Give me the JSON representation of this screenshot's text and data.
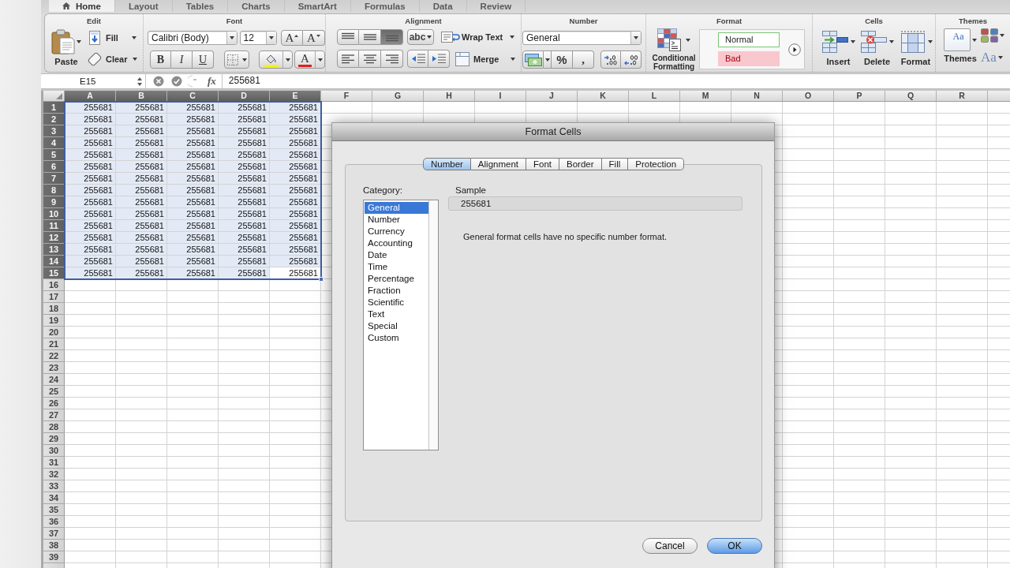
{
  "ribbon_tabs": [
    {
      "label": "Home",
      "selected": true
    },
    {
      "label": "Layout",
      "selected": false
    },
    {
      "label": "Tables",
      "selected": false
    },
    {
      "label": "Charts",
      "selected": false
    },
    {
      "label": "SmartArt",
      "selected": false
    },
    {
      "label": "Formulas",
      "selected": false
    },
    {
      "label": "Data",
      "selected": false
    },
    {
      "label": "Review",
      "selected": false
    }
  ],
  "ribbon": {
    "edit": {
      "title": "Edit",
      "paste": "Paste",
      "fill": "Fill",
      "clear": "Clear"
    },
    "font": {
      "title": "Font",
      "font_name": "Calibri (Body)",
      "font_size": "12",
      "grow_font": "A",
      "shrink_font": "A",
      "bold": "B",
      "italic": "I",
      "underline": "U",
      "font_color": "A"
    },
    "alignment": {
      "title": "Alignment",
      "vertical": [
        {
          "kind": "top",
          "selected": false
        },
        {
          "kind": "middle",
          "selected": false
        },
        {
          "kind": "bottom",
          "selected": true
        }
      ],
      "orientation": "abc",
      "wrap_text": "Wrap Text",
      "horizontal": [
        {
          "kind": "left",
          "selected": false
        },
        {
          "kind": "center",
          "selected": false
        },
        {
          "kind": "right",
          "selected": false
        }
      ],
      "merge": "Merge"
    },
    "number": {
      "title": "Number",
      "format": "General",
      "percent": "%",
      "comma": ","
    },
    "format": {
      "title": "Format",
      "conditional_formatting": "Conditional Formatting",
      "styles": [
        {
          "label": "Normal",
          "kind": "normal"
        },
        {
          "label": "Bad",
          "kind": "bad"
        }
      ]
    },
    "cells": {
      "title": "Cells",
      "buttons": [
        {
          "label": "Insert",
          "kind": "insert"
        },
        {
          "label": "Delete",
          "kind": "delete"
        },
        {
          "label": "Format",
          "kind": "format"
        }
      ]
    },
    "themes": {
      "title": "Themes",
      "button": "Themes",
      "preview": "Aa",
      "fonts": "Aa"
    }
  },
  "formula_bar": {
    "name_box": "E15",
    "function_label": "fx",
    "value": "255681"
  },
  "sheet": {
    "columns": [
      {
        "label": "A",
        "selected": true
      },
      {
        "label": "B",
        "selected": true
      },
      {
        "label": "C",
        "selected": true
      },
      {
        "label": "D",
        "selected": true
      },
      {
        "label": "E",
        "selected": true
      },
      {
        "label": "F",
        "selected": false
      },
      {
        "label": "G",
        "selected": false
      },
      {
        "label": "H",
        "selected": false
      },
      {
        "label": "I",
        "selected": false
      },
      {
        "label": "J",
        "selected": false
      },
      {
        "label": "K",
        "selected": false
      },
      {
        "label": "L",
        "selected": false
      },
      {
        "label": "M",
        "selected": false
      },
      {
        "label": "N",
        "selected": false
      },
      {
        "label": "O",
        "selected": false
      },
      {
        "label": "P",
        "selected": false
      },
      {
        "label": "Q",
        "selected": false
      },
      {
        "label": "R",
        "selected": false
      }
    ],
    "rows": [
      {
        "label": "1",
        "selected": true,
        "cells": [
          {
            "value": "255681",
            "active": false
          },
          {
            "value": "255681",
            "active": false
          },
          {
            "value": "255681",
            "active": false
          },
          {
            "value": "255681",
            "active": false
          },
          {
            "value": "255681",
            "active": false
          }
        ]
      },
      {
        "label": "2",
        "selected": true,
        "cells": [
          {
            "value": "255681",
            "active": false
          },
          {
            "value": "255681",
            "active": false
          },
          {
            "value": "255681",
            "active": false
          },
          {
            "value": "255681",
            "active": false
          },
          {
            "value": "255681",
            "active": false
          }
        ]
      },
      {
        "label": "3",
        "selected": true,
        "cells": [
          {
            "value": "255681",
            "active": false
          },
          {
            "value": "255681",
            "active": false
          },
          {
            "value": "255681",
            "active": false
          },
          {
            "value": "255681",
            "active": false
          },
          {
            "value": "255681",
            "active": false
          }
        ]
      },
      {
        "label": "4",
        "selected": true,
        "cells": [
          {
            "value": "255681",
            "active": false
          },
          {
            "value": "255681",
            "active": false
          },
          {
            "value": "255681",
            "active": false
          },
          {
            "value": "255681",
            "active": false
          },
          {
            "value": "255681",
            "active": false
          }
        ]
      },
      {
        "label": "5",
        "selected": true,
        "cells": [
          {
            "value": "255681",
            "active": false
          },
          {
            "value": "255681",
            "active": false
          },
          {
            "value": "255681",
            "active": false
          },
          {
            "value": "255681",
            "active": false
          },
          {
            "value": "255681",
            "active": false
          }
        ]
      },
      {
        "label": "6",
        "selected": true,
        "cells": [
          {
            "value": "255681",
            "active": false
          },
          {
            "value": "255681",
            "active": false
          },
          {
            "value": "255681",
            "active": false
          },
          {
            "value": "255681",
            "active": false
          },
          {
            "value": "255681",
            "active": false
          }
        ]
      },
      {
        "label": "7",
        "selected": true,
        "cells": [
          {
            "value": "255681",
            "active": false
          },
          {
            "value": "255681",
            "active": false
          },
          {
            "value": "255681",
            "active": false
          },
          {
            "value": "255681",
            "active": false
          },
          {
            "value": "255681",
            "active": false
          }
        ]
      },
      {
        "label": "8",
        "selected": true,
        "cells": [
          {
            "value": "255681",
            "active": false
          },
          {
            "value": "255681",
            "active": false
          },
          {
            "value": "255681",
            "active": false
          },
          {
            "value": "255681",
            "active": false
          },
          {
            "value": "255681",
            "active": false
          }
        ]
      },
      {
        "label": "9",
        "selected": true,
        "cells": [
          {
            "value": "255681",
            "active": false
          },
          {
            "value": "255681",
            "active": false
          },
          {
            "value": "255681",
            "active": false
          },
          {
            "value": "255681",
            "active": false
          },
          {
            "value": "255681",
            "active": false
          }
        ]
      },
      {
        "label": "10",
        "selected": true,
        "cells": [
          {
            "value": "255681",
            "active": false
          },
          {
            "value": "255681",
            "active": false
          },
          {
            "value": "255681",
            "active": false
          },
          {
            "value": "255681",
            "active": false
          },
          {
            "value": "255681",
            "active": false
          }
        ]
      },
      {
        "label": "11",
        "selected": true,
        "cells": [
          {
            "value": "255681",
            "active": false
          },
          {
            "value": "255681",
            "active": false
          },
          {
            "value": "255681",
            "active": false
          },
          {
            "value": "255681",
            "active": false
          },
          {
            "value": "255681",
            "active": false
          }
        ]
      },
      {
        "label": "12",
        "selected": true,
        "cells": [
          {
            "value": "255681",
            "active": false
          },
          {
            "value": "255681",
            "active": false
          },
          {
            "value": "255681",
            "active": false
          },
          {
            "value": "255681",
            "active": false
          },
          {
            "value": "255681",
            "active": false
          }
        ]
      },
      {
        "label": "13",
        "selected": true,
        "cells": [
          {
            "value": "255681",
            "active": false
          },
          {
            "value": "255681",
            "active": false
          },
          {
            "value": "255681",
            "active": false
          },
          {
            "value": "255681",
            "active": false
          },
          {
            "value": "255681",
            "active": false
          }
        ]
      },
      {
        "label": "14",
        "selected": true,
        "cells": [
          {
            "value": "255681",
            "active": false
          },
          {
            "value": "255681",
            "active": false
          },
          {
            "value": "255681",
            "active": false
          },
          {
            "value": "255681",
            "active": false
          },
          {
            "value": "255681",
            "active": false
          }
        ]
      },
      {
        "label": "15",
        "selected": true,
        "cells": [
          {
            "value": "255681",
            "active": false
          },
          {
            "value": "255681",
            "active": false
          },
          {
            "value": "255681",
            "active": false
          },
          {
            "value": "255681",
            "active": false
          },
          {
            "value": "255681",
            "active": true
          }
        ]
      },
      {
        "label": "16",
        "selected": false
      },
      {
        "label": "17",
        "selected": false
      },
      {
        "label": "18",
        "selected": false
      },
      {
        "label": "19",
        "selected": false
      },
      {
        "label": "20",
        "selected": false
      },
      {
        "label": "21",
        "selected": false
      },
      {
        "label": "22",
        "selected": false
      },
      {
        "label": "23",
        "selected": false
      },
      {
        "label": "24",
        "selected": false
      },
      {
        "label": "25",
        "selected": false
      },
      {
        "label": "26",
        "selected": false
      },
      {
        "label": "27",
        "selected": false
      },
      {
        "label": "28",
        "selected": false
      },
      {
        "label": "29",
        "selected": false
      },
      {
        "label": "30",
        "selected": false
      },
      {
        "label": "31",
        "selected": false
      },
      {
        "label": "32",
        "selected": false
      },
      {
        "label": "33",
        "selected": false
      },
      {
        "label": "34",
        "selected": false
      },
      {
        "label": "35",
        "selected": false
      },
      {
        "label": "36",
        "selected": false
      },
      {
        "label": "37",
        "selected": false
      },
      {
        "label": "38",
        "selected": false
      },
      {
        "label": "39",
        "selected": false
      },
      {
        "selected": false
      }
    ]
  },
  "dialog": {
    "title": "Format Cells",
    "tabs": [
      {
        "label": "Number",
        "selected": true
      },
      {
        "label": "Alignment",
        "selected": false
      },
      {
        "label": "Font",
        "selected": false
      },
      {
        "label": "Border",
        "selected": false
      },
      {
        "label": "Fill",
        "selected": false
      },
      {
        "label": "Protection",
        "selected": false
      }
    ],
    "category_label": "Category:",
    "categories": [
      {
        "label": "General",
        "selected": true
      },
      {
        "label": "Number",
        "selected": false
      },
      {
        "label": "Currency",
        "selected": false
      },
      {
        "label": "Accounting",
        "selected": false
      },
      {
        "label": "Date",
        "selected": false
      },
      {
        "label": "Time",
        "selected": false
      },
      {
        "label": "Percentage",
        "selected": false
      },
      {
        "label": "Fraction",
        "selected": false
      },
      {
        "label": "Scientific",
        "selected": false
      },
      {
        "label": "Text",
        "selected": false
      },
      {
        "label": "Special",
        "selected": false
      },
      {
        "label": "Custom",
        "selected": false
      }
    ],
    "sample_label": "Sample",
    "sample_value": "255681",
    "description": "General format cells have no specific number format.",
    "buttons": [
      {
        "label": "Cancel",
        "default": false
      },
      {
        "label": "OK",
        "default": true
      }
    ]
  }
}
